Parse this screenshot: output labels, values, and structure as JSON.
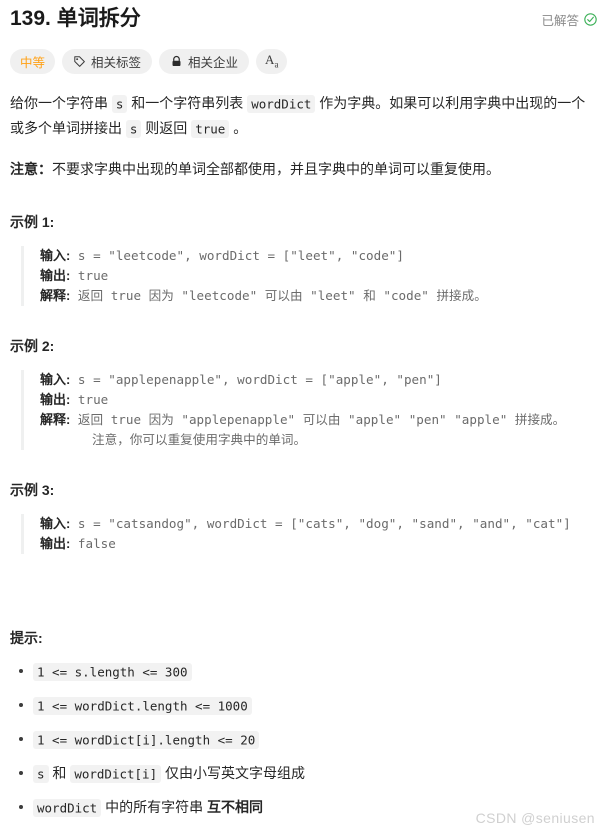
{
  "header": {
    "title": "139. 单词拆分",
    "status_label": "已解答",
    "status_icon": "check-circle-icon",
    "status_color": "#3eb15a"
  },
  "badges": {
    "difficulty": {
      "label": "中等",
      "color": "#ffa116"
    },
    "topics": {
      "label": "相关标签",
      "icon": "tag-icon"
    },
    "companies": {
      "label": "相关企业",
      "icon": "lock-icon"
    },
    "font_size": {
      "label": "Aa",
      "icon": "font-size-icon"
    }
  },
  "description": {
    "p1_part1": "给你一个字符串 ",
    "p1_code1": "s",
    "p1_part2": " 和一个字符串列表 ",
    "p1_code2": "wordDict",
    "p1_part3": " 作为字典。如果可以利用字典中出现的一个或多个单词拼接出 ",
    "p1_code3": "s",
    "p1_part4": " 则返回 ",
    "p1_code4": "true",
    "p1_part5": " 。",
    "p2_bold": "注意：",
    "p2_text": "不要求字典中出现的单词全部都使用，并且字典中的单词可以重复使用。"
  },
  "examples": [
    {
      "heading": "示例 1:",
      "input_label": "输入:",
      "input_value": " s = \"leetcode\", wordDict = [\"leet\", \"code\"]",
      "output_label": "输出:",
      "output_value": " true",
      "explain_label": "解释:",
      "explain_value": " 返回 true 因为 \"leetcode\" 可以由 \"leet\" 和 \"code\" 拼接成。",
      "note": ""
    },
    {
      "heading": "示例 2:",
      "input_label": "输入:",
      "input_value": " s = \"applepenapple\", wordDict = [\"apple\", \"pen\"]",
      "output_label": "输出:",
      "output_value": " true",
      "explain_label": "解释:",
      "explain_value": " 返回 true 因为 \"applepenapple\" 可以由 \"apple\" \"pen\" \"apple\" 拼接成。",
      "note": "注意，你可以重复使用字典中的单词。"
    },
    {
      "heading": "示例 3:",
      "input_label": "输入:",
      "input_value": " s = \"catsandog\", wordDict = [\"cats\", \"dog\", \"sand\", \"and\", \"cat\"]",
      "output_label": "输出:",
      "output_value": " false",
      "explain_label": "",
      "explain_value": "",
      "note": ""
    }
  ],
  "hints": {
    "heading": "提示:",
    "items": [
      {
        "code1": "1 <= s.length <= 300",
        "text1": "",
        "code2": "",
        "text2": "",
        "bold_text": ""
      },
      {
        "code1": "1 <= wordDict.length <= 1000",
        "text1": "",
        "code2": "",
        "text2": "",
        "bold_text": ""
      },
      {
        "code1": "1 <= wordDict[i].length <= 20",
        "text1": "",
        "code2": "",
        "text2": "",
        "bold_text": ""
      },
      {
        "code1": "s",
        "text1": " 和 ",
        "code2": "wordDict[i]",
        "text2": " 仅由小写英文字母组成",
        "bold_text": ""
      },
      {
        "code1": "wordDict",
        "text1": " 中的所有字符串 ",
        "code2": "",
        "text2": "",
        "bold_text": "互不相同"
      }
    ]
  },
  "watermark": "CSDN @seniusen"
}
